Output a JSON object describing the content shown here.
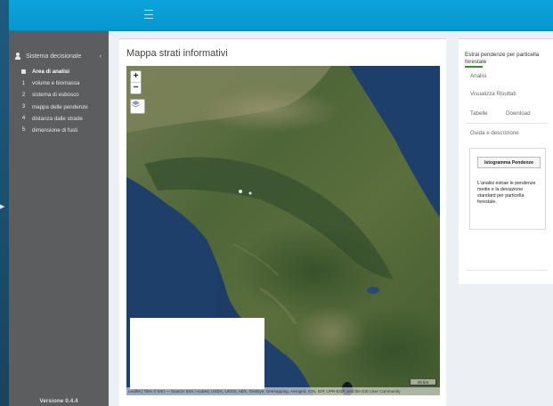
{
  "sidebar": {
    "header": "Sistema decisionale",
    "collapse_icon": "‹",
    "items": [
      {
        "icon": "▦",
        "label": "Area di analisi",
        "active": true
      },
      {
        "icon": "1",
        "label": "volume e biomassa"
      },
      {
        "icon": "2",
        "label": "sistema di esbosco"
      },
      {
        "icon": "3",
        "label": "mappa delle pendenze"
      },
      {
        "icon": "4",
        "label": "distanza dalle strade"
      },
      {
        "icon": "5",
        "label": "dimensione di fusti"
      }
    ],
    "version": "Versione 0.4.4"
  },
  "main": {
    "title": "Mappa strati informativi",
    "zoom_in": "+",
    "zoom_out": "−",
    "attribution": "Leaflet | Tiles © Esri — Source: Esri, i-cubed, USDA, USGS, AEX, GeoEye, Getmapping, Aerogrid, IGN, IGP, UPR-EGP, and the GIS User Community",
    "scale_label": "20 km"
  },
  "right_panel": {
    "title": "Estrai pendenze per particella forestale",
    "links": {
      "analisi": "Analisi",
      "visualizza": "Visualizza Risultati",
      "tabelle": "Tabelle",
      "download": "Download",
      "guida": "Guida e descrizione"
    },
    "badge": "Istogramma Pendenze",
    "description": "L'analisi estrae le pendenze medie e la deviazione standard per particella forestale."
  },
  "colors": {
    "topbar": "#0ca3dc",
    "sidebar": "#5b5d5f",
    "accent_green": "#3c8d2f",
    "sea": "#1d3d66"
  }
}
